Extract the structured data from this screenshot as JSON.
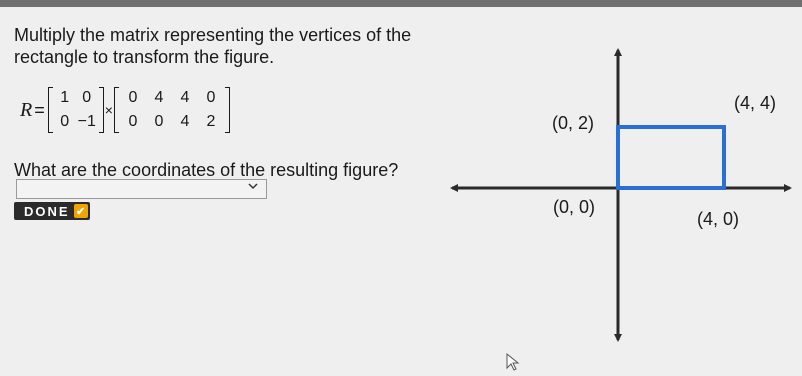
{
  "question": "Multiply the matrix representing the vertices of the rectangle to transform the figure.",
  "equation": {
    "variable": "R",
    "equals": "=",
    "times": "×",
    "matrix_a": [
      [
        "1",
        "0"
      ],
      [
        "0",
        "−1"
      ]
    ],
    "matrix_b": [
      [
        "0",
        "4",
        "4",
        "0"
      ],
      [
        "0",
        "0",
        "4",
        "2"
      ]
    ]
  },
  "prompt": "What are the coordinates of the resulting figure?",
  "answer": {
    "value": "",
    "icon": "chevron-down-icon"
  },
  "done_button": {
    "label": "DONE",
    "icon": "check-icon"
  },
  "graph": {
    "labels": {
      "p04": "(0, 2)",
      "p44": "(4, 4)",
      "p00": "(0, 0)",
      "p40": "(4, 0)"
    },
    "rectangle_color": "#2a6fd4"
  }
}
